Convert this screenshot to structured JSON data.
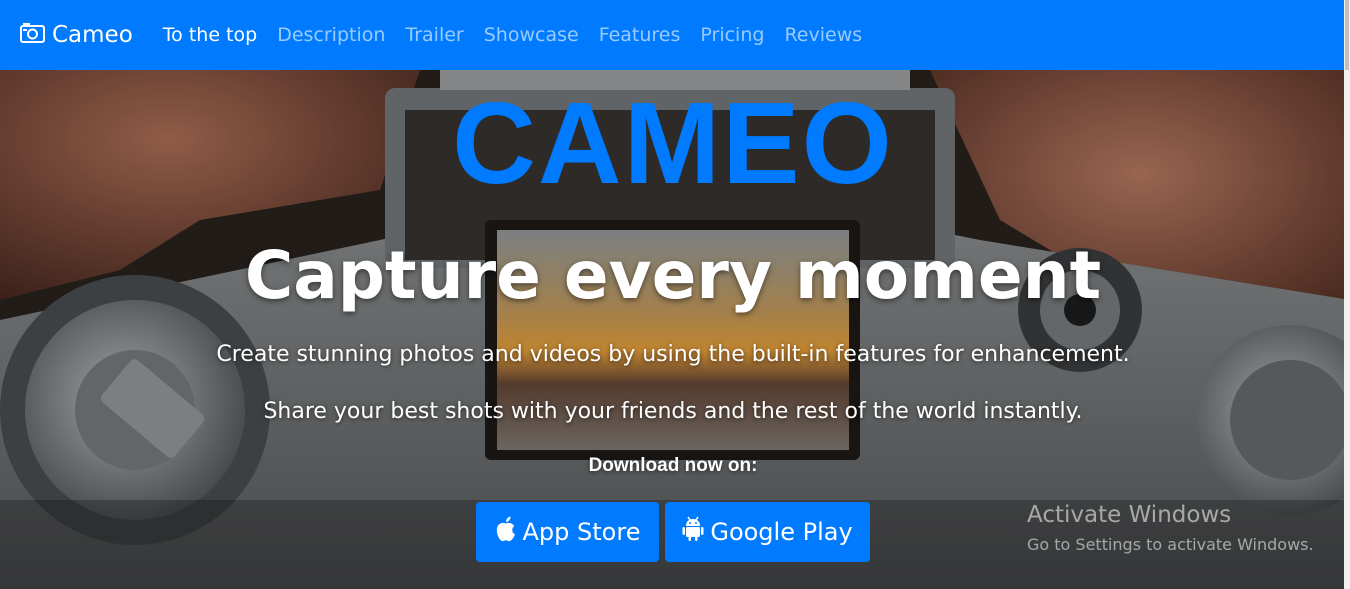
{
  "brand": {
    "name": "Cameo",
    "icon": "camera-icon"
  },
  "nav": {
    "links": [
      {
        "label": "To the top",
        "active": true
      },
      {
        "label": "Description",
        "active": false
      },
      {
        "label": "Trailer",
        "active": false
      },
      {
        "label": "Showcase",
        "active": false
      },
      {
        "label": "Features",
        "active": false
      },
      {
        "label": "Pricing",
        "active": false
      },
      {
        "label": "Reviews",
        "active": false
      }
    ]
  },
  "hero": {
    "title": "CAMEO",
    "headline": "Capture every moment",
    "lead_1": "Create stunning photos and videos by using the built-in features for enhancement.",
    "lead_2": "Share your best shots with your friends and the rest of the world instantly.",
    "download_label": "Download now on:",
    "buttons": {
      "app_store": {
        "label": "App Store",
        "icon": "apple-icon"
      },
      "google_play": {
        "label": "Google Play",
        "icon": "android-icon"
      }
    }
  },
  "watermark": {
    "title": "Activate Windows",
    "subtitle": "Go to Settings to activate Windows."
  },
  "colors": {
    "primary": "#007bff",
    "nav_link_inactive": "rgba(255,255,255,0.6)",
    "text_on_hero": "#ffffff"
  }
}
